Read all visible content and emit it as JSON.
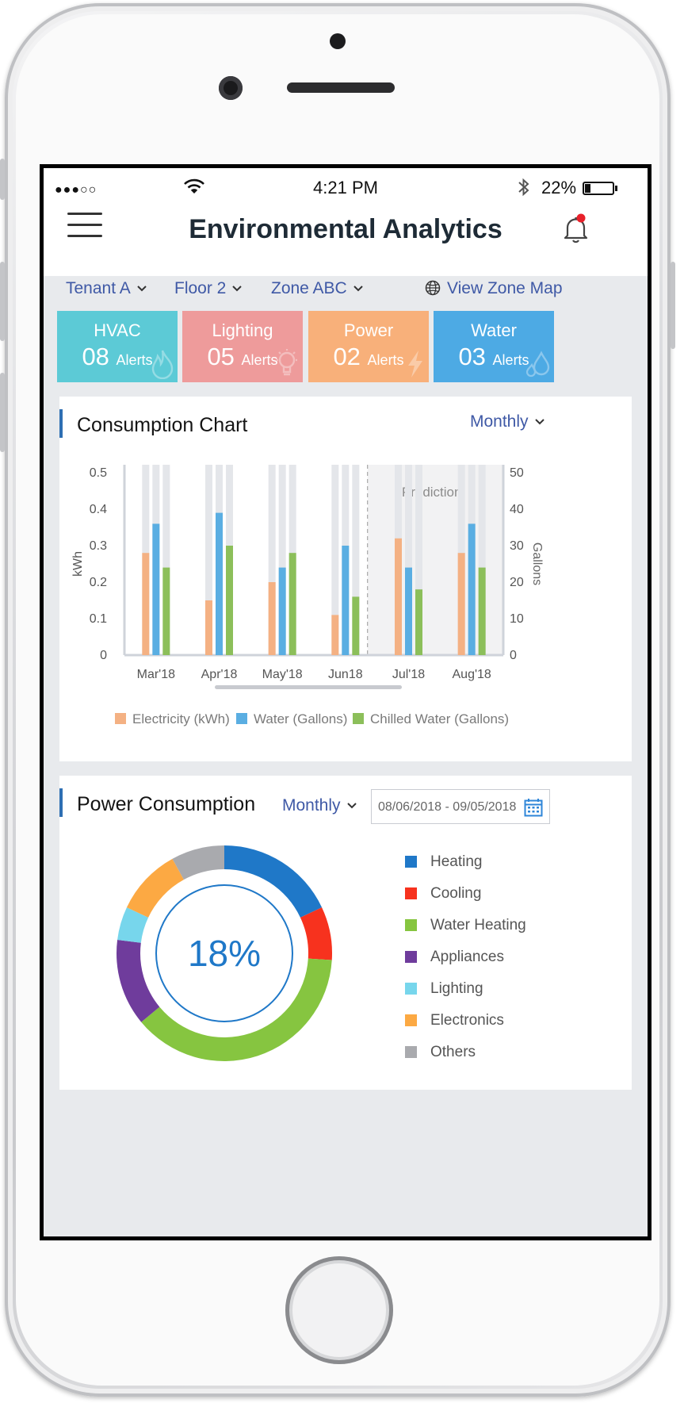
{
  "status_bar": {
    "signal_dots": "●●●○○",
    "time": "4:21 PM",
    "battery": "22%",
    "battery_level": 0.22
  },
  "header": {
    "title": "Environmental Analytics",
    "menu_icon": "hamburger-menu-icon",
    "notification_icon": "bell-icon",
    "notification_dot_color": "#e8202a"
  },
  "filters": {
    "tenant": "Tenant A",
    "floor": "Floor 2",
    "zone": "Zone ABC",
    "map_link": "View Zone Map"
  },
  "alerts": [
    {
      "name": "HVAC",
      "count": "08",
      "unit": "Alerts",
      "color": "#5ccad6",
      "icon": "flame-icon"
    },
    {
      "name": "Lighting",
      "count": "05",
      "unit": "Alerts",
      "color": "#ee9b9b",
      "icon": "bulb-icon"
    },
    {
      "name": "Power",
      "count": "02",
      "unit": "Alerts",
      "color": "#f8b07a",
      "icon": "bolt-icon"
    },
    {
      "name": "Water",
      "count": "03",
      "unit": "Alerts",
      "color": "#4daae4",
      "icon": "water-drop-icon"
    }
  ],
  "consumption_chart": {
    "title": "Consumption Chart",
    "period": "Monthly",
    "prediction_label": "Prediction"
  },
  "power_consumption": {
    "title": "Power Consumption",
    "period": "Monthly",
    "date_range": "08/06/2018 - 09/05/2018",
    "center_value": "18%"
  },
  "chart_data": [
    {
      "type": "bar",
      "categories": [
        "Mar'18",
        "Apr'18",
        "May'18",
        "Jun18",
        "Jul'18",
        "Aug'18"
      ],
      "series": [
        {
          "name": "Electricity (kWh)",
          "axis": "left",
          "color": "#f4b183",
          "values": [
            0.28,
            0.15,
            0.2,
            0.11,
            0.32,
            0.28
          ]
        },
        {
          "name": "Water (Gallons)",
          "axis": "right",
          "color": "#5aaee2",
          "values": [
            36,
            39,
            24,
            30,
            24,
            36
          ]
        },
        {
          "name": "Chilled Water (Gallons)",
          "axis": "right",
          "color": "#8cbf5a",
          "values": [
            24,
            30,
            28,
            16,
            18,
            24
          ]
        }
      ],
      "ylabel": "kWh",
      "ylabel_right": "Gallons",
      "ylim": [
        0,
        0.5
      ],
      "ylim_right": [
        0,
        50
      ],
      "yticks": [
        "0",
        "0.1",
        "0.2",
        "0.3",
        "0.4",
        "0.5"
      ],
      "yticks_right": [
        "0",
        "10",
        "20",
        "30",
        "40",
        "50"
      ],
      "prediction_categories": [
        "Jul'18",
        "Aug'18"
      ],
      "legend_position": "bottom"
    },
    {
      "type": "pie",
      "style": "donut",
      "categories": [
        "Heating",
        "Cooling",
        "Water Heating",
        "Appliances",
        "Lighting",
        "Electronics",
        "Others"
      ],
      "colors": [
        "#1f78c8",
        "#f7321e",
        "#86c540",
        "#6f3c9c",
        "#77d6ec",
        "#fca943",
        "#a9aaae"
      ],
      "values": [
        18,
        8,
        38,
        13,
        5,
        10,
        8
      ],
      "center_label": "18%",
      "legend_position": "right"
    }
  ]
}
